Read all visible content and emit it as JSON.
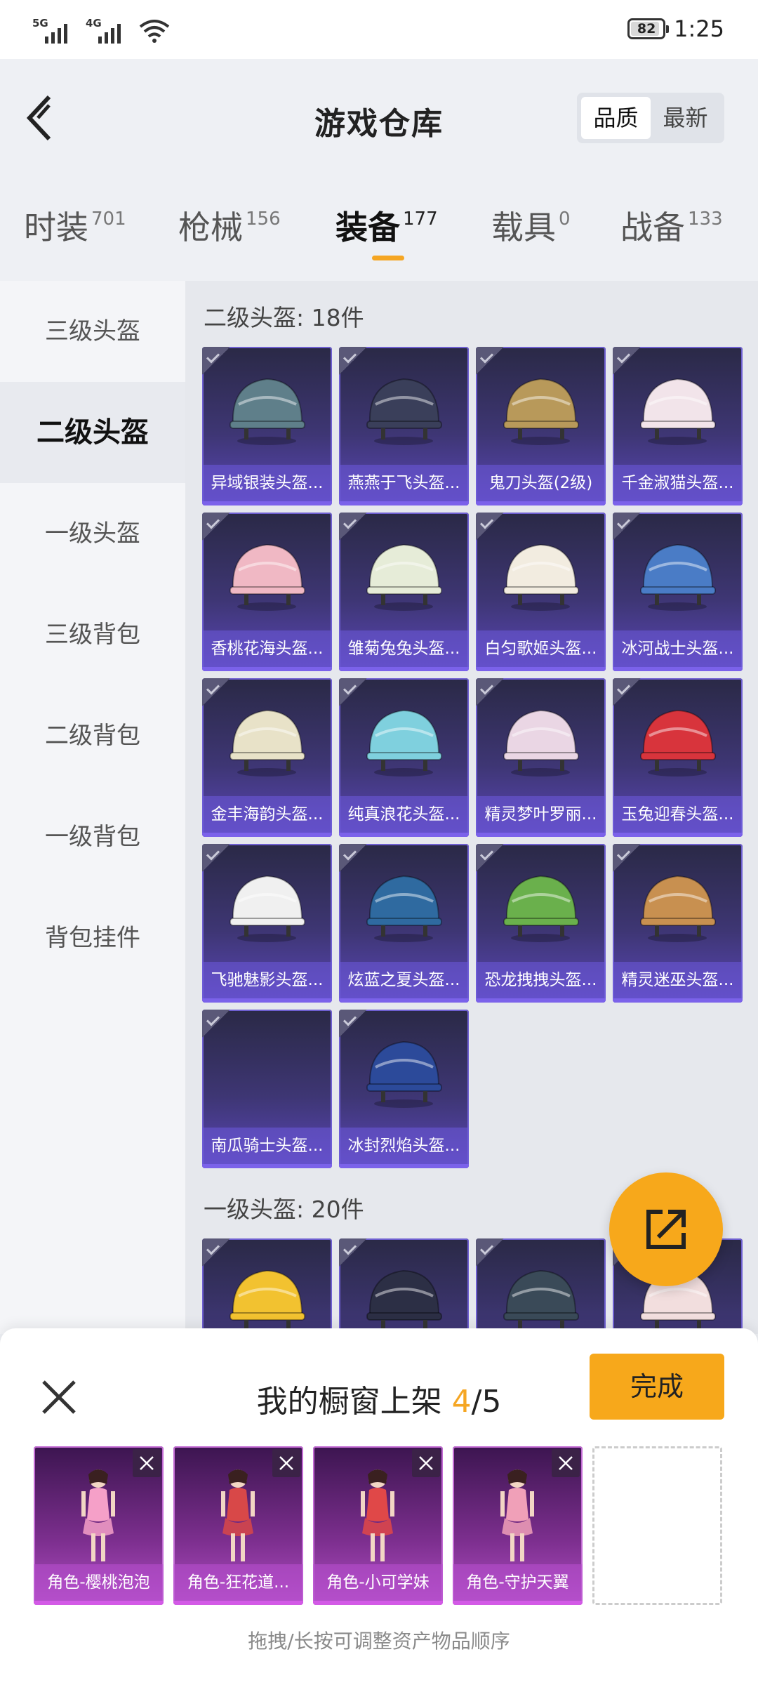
{
  "status_bar": {
    "signal1": "5G",
    "signal2": "4G",
    "battery": "82",
    "time": "1:25"
  },
  "header": {
    "title": "游戏仓库",
    "sort_options": [
      "品质",
      "最新"
    ],
    "sort_selected": "品质"
  },
  "tabs": [
    {
      "label": "时装",
      "count": "701"
    },
    {
      "label": "枪械",
      "count": "156"
    },
    {
      "label": "装备",
      "count": "177"
    },
    {
      "label": "载具",
      "count": "0"
    },
    {
      "label": "战备",
      "count": "133"
    }
  ],
  "active_tab": "装备",
  "sidebar": {
    "items": [
      "三级头盔",
      "二级头盔",
      "一级头盔",
      "三级背包",
      "二级背包",
      "一级背包",
      "背包挂件"
    ],
    "active": "二级头盔"
  },
  "sections": [
    {
      "title": "二级头盔: 18件",
      "items": [
        {
          "name": "异域银装头盔...",
          "color": "#5f7f8a"
        },
        {
          "name": "燕燕于飞头盔...",
          "color": "#3a3f5a"
        },
        {
          "name": "鬼刀头盔(2级)",
          "color": "#b8995a"
        },
        {
          "name": "千金淑猫头盔...",
          "color": "#f2e4ea"
        },
        {
          "name": "香桃花海头盔...",
          "color": "#f0b8c4"
        },
        {
          "name": "雏菊兔兔头盔...",
          "color": "#e6ecd8"
        },
        {
          "name": "白匀歌姬头盔...",
          "color": "#f2ece0"
        },
        {
          "name": "冰河战士头盔...",
          "color": "#4a7cc6"
        },
        {
          "name": "金丰海韵头盔...",
          "color": "#e8e2c8"
        },
        {
          "name": "纯真浪花头盔...",
          "color": "#7fd0de"
        },
        {
          "name": "精灵梦叶罗丽...",
          "color": "#ead6e4"
        },
        {
          "name": "玉兔迎春头盔...",
          "color": "#d8343c"
        },
        {
          "name": "飞驰魅影头盔...",
          "color": "#f0f0f0"
        },
        {
          "name": "炫蓝之夏头盔...",
          "color": "#2f6aa0"
        },
        {
          "name": "恐龙拽拽头盔...",
          "color": "#6ab04c"
        },
        {
          "name": "精灵迷巫头盔...",
          "color": "#c89050"
        },
        {
          "name": "南瓜骑士头盔...",
          "color": ""
        },
        {
          "name": "冰封烈焰头盔...",
          "color": "#2c4a9a"
        }
      ]
    },
    {
      "title": "一级头盔: 20件",
      "items": [
        {
          "name": "",
          "color": "#f2c230"
        },
        {
          "name": "",
          "color": "#2c2f45"
        },
        {
          "name": "",
          "color": "#3a4a58"
        },
        {
          "name": "",
          "color": "#f2dede"
        }
      ]
    }
  ],
  "panel": {
    "title": "我的橱窗上架",
    "count": "4",
    "total": "/5",
    "done_label": "完成",
    "slots": [
      {
        "name": "角色-樱桃泡泡",
        "color": "#f5a0c8"
      },
      {
        "name": "角色-狂花道...",
        "color": "#d84848"
      },
      {
        "name": "角色-小可学妹",
        "color": "#e04848"
      },
      {
        "name": "角色-守护天翼",
        "color": "#f0a0b8"
      }
    ],
    "hint": "拖拽/长按可调整资产物品顺序"
  }
}
